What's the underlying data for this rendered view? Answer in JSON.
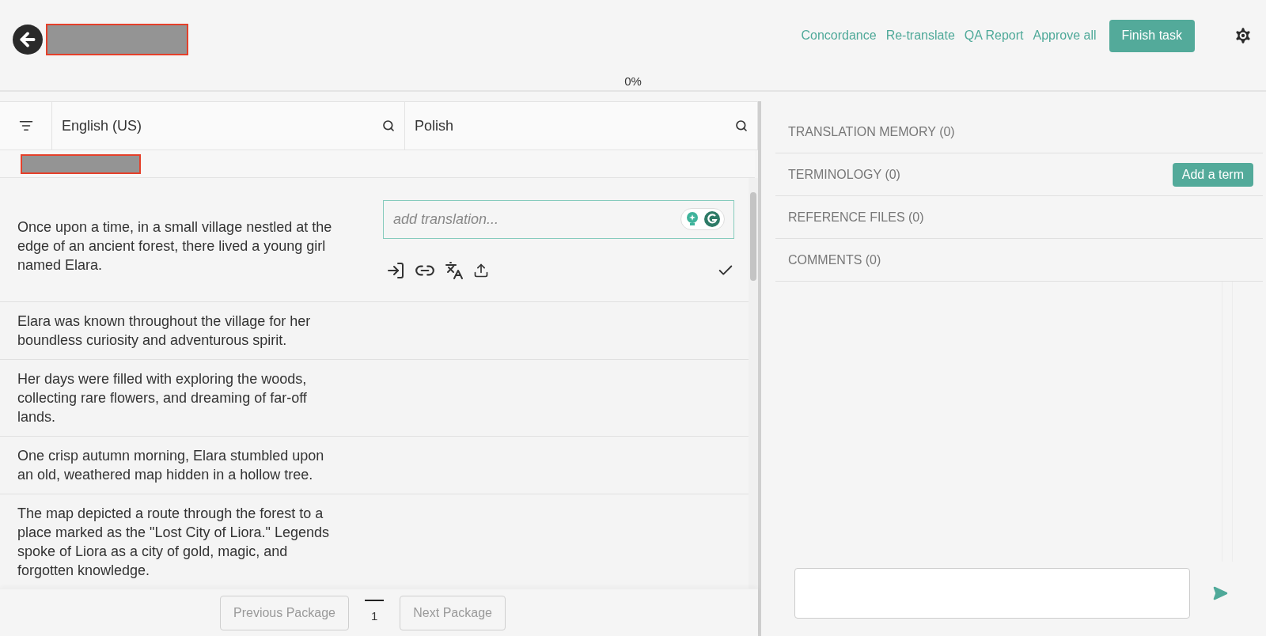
{
  "header": {
    "links": [
      "Concordance",
      "Re-translate",
      "QA Report",
      "Approve all"
    ],
    "finish_button": "Finish task",
    "progress": "0%"
  },
  "editor": {
    "columns": [
      {
        "label": "English (US)"
      },
      {
        "label": "Polish"
      }
    ],
    "segments": [
      {
        "source": "Once upon a time, in a small village nestled at the edge of an ancient forest, there lived a young girl named Elara.",
        "selected": true,
        "placeholder": "add translation..."
      },
      {
        "source": "Elara was known throughout the village for her boundless curiosity and adventurous spirit.",
        "selected": false
      },
      {
        "source": "Her days were filled with exploring the woods, collecting rare flowers, and dreaming of far-off lands.",
        "selected": false
      },
      {
        "source": "One crisp autumn morning, Elara stumbled upon an old, weathered map hidden in a hollow tree.",
        "selected": false
      },
      {
        "source": "The map depicted a route through the forest to a place marked as the \"Lost City of Liora.\" Legends spoke of Liora as a city of gold, magic, and forgotten knowledge.",
        "selected": false
      }
    ],
    "pager": {
      "previous": {
        "label": "Previous Package",
        "disabled": true
      },
      "pages": [
        {
          "label": "1",
          "selected": true
        }
      ],
      "next": {
        "label": "Next Package",
        "disabled": true
      }
    }
  },
  "side_panel": {
    "sections": [
      {
        "title": "TRANSLATION MEMORY (0)"
      },
      {
        "title": "TERMINOLOGY (0)",
        "button": "Add a term"
      },
      {
        "title": "REFERENCE FILES (0)"
      },
      {
        "title": "COMMENTS (0)"
      }
    ]
  }
}
